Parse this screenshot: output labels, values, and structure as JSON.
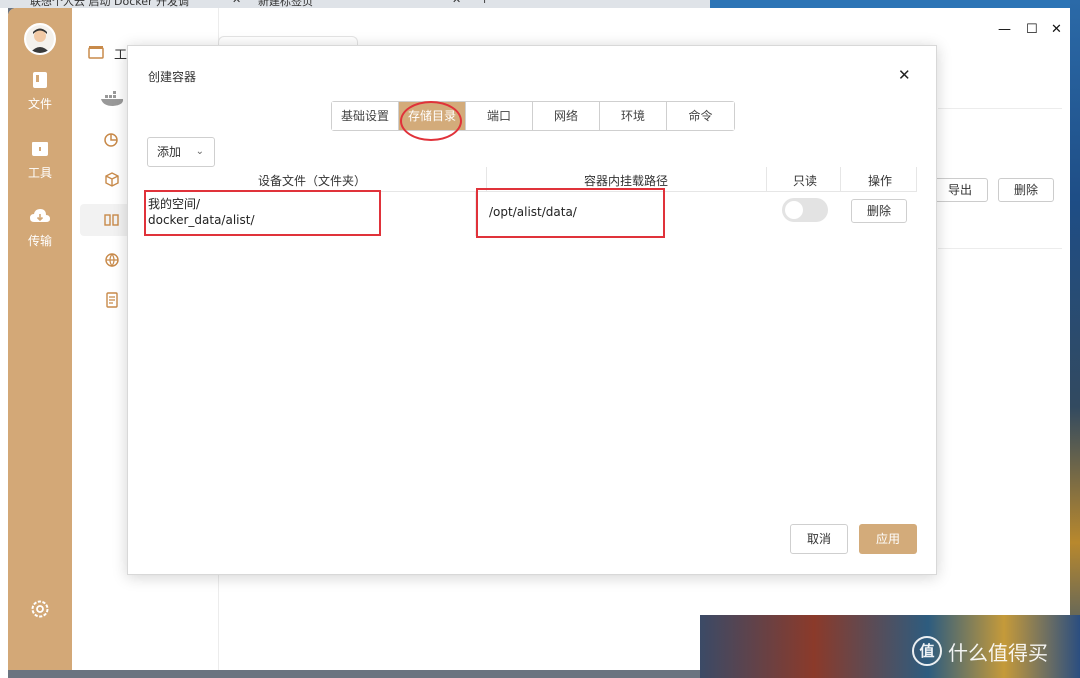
{
  "browser": {
    "tabs": [
      {
        "label": "联想个人云 启动 Docker 开发调"
      },
      {
        "label": "新建标签页"
      }
    ],
    "new_tab_symbol": "+"
  },
  "rail": {
    "items": [
      {
        "label": "文件",
        "icon": "file-icon"
      },
      {
        "label": "工具",
        "icon": "toolbox-icon"
      },
      {
        "label": "传输",
        "icon": "cloud-transfer-icon"
      }
    ],
    "settings_icon": "gear-icon"
  },
  "window": {
    "title_partial": "工",
    "controls": {
      "min": "—",
      "max": "☐",
      "close": "✕"
    }
  },
  "background": {
    "buttons": [
      {
        "label": "导出"
      },
      {
        "label": "删除"
      }
    ]
  },
  "modal": {
    "title": "创建容器",
    "close_symbol": "✕",
    "tabs": [
      {
        "label": "基础设置",
        "active": false
      },
      {
        "label": "存储目录",
        "active": true
      },
      {
        "label": "端口",
        "active": false
      },
      {
        "label": "网络",
        "active": false
      },
      {
        "label": "环境",
        "active": false
      },
      {
        "label": "命令",
        "active": false
      }
    ],
    "add_select": {
      "value": "添加"
    },
    "table": {
      "headers": {
        "device": "设备文件（文件夹）",
        "container": "容器内挂载路径",
        "readonly": "只读",
        "action": "操作"
      },
      "rows": [
        {
          "device_line1": "我的空间/",
          "device_line2": "docker_data/alist/",
          "container_path": "/opt/alist/data/",
          "readonly": false,
          "action_label": "删除"
        }
      ]
    },
    "footer": {
      "cancel": "取消",
      "apply": "应用"
    }
  },
  "colors": {
    "accent": "#d3ab7a",
    "rail": "#d3a877",
    "annotation_red": "#e0323a"
  },
  "watermark": {
    "logo_glyph": "值",
    "text": "什么值得买"
  }
}
